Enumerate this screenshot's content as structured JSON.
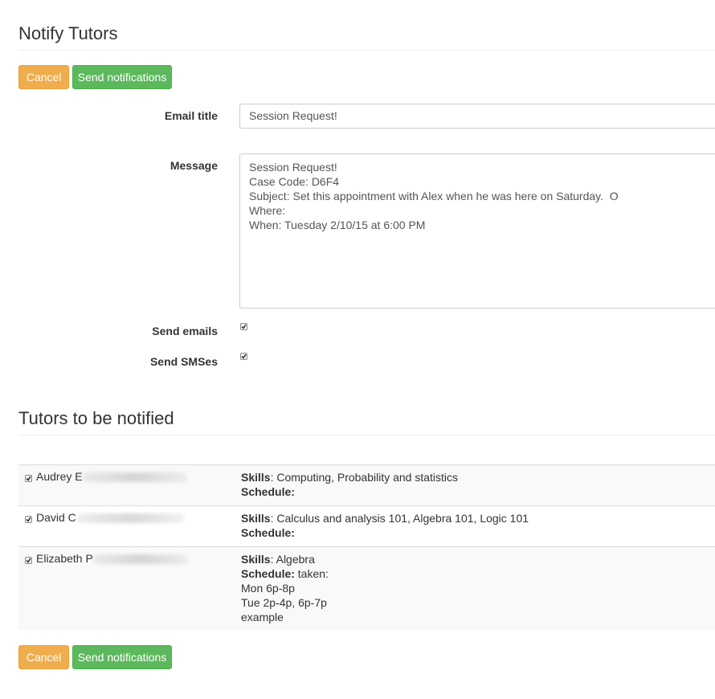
{
  "page": {
    "title": "Notify Tutors",
    "section_title": "Tutors to be notified"
  },
  "toolbar": {
    "cancel_label": "Cancel",
    "send_label": "Send notifications"
  },
  "form": {
    "email_title_label": "Email title",
    "email_title_value": "Session Request!",
    "message_label": "Message",
    "message_value": "Session Request!\nCase Code: D6F4\nSubject: Set this appointment with Alex when he was here on Saturday.  O\nWhere:\nWhen: Tuesday 2/10/15 at 6:00 PM",
    "send_emails_label": "Send emails",
    "send_emails_checked": true,
    "send_smses_label": "Send SMSes",
    "send_smses_checked": true
  },
  "tutors": [
    {
      "name_visible": "Audrey E",
      "checked": true,
      "skills_label": "Skills",
      "skills": ": Computing, Probability and statistics",
      "schedule_label": "Schedule:",
      "schedule": ""
    },
    {
      "name_visible": "David C",
      "checked": true,
      "skills_label": "Skills",
      "skills": ": Calculus and analysis 101, Algebra 101, Logic 101",
      "schedule_label": "Schedule:",
      "schedule": ""
    },
    {
      "name_visible": "Elizabeth P",
      "checked": true,
      "skills_label": "Skills",
      "skills": ": Algebra",
      "schedule_label": "Schedule:",
      "schedule": " taken:\nMon 6p-8p\nTue 2p-4p, 6p-7p\nexample"
    }
  ],
  "colors": {
    "cancel": "#f0ad4e",
    "send": "#5cb85c",
    "stripe": "#f9f9f9",
    "border": "#dddddd"
  },
  "icons": {
    "checkbox": "checkmark-icon"
  }
}
